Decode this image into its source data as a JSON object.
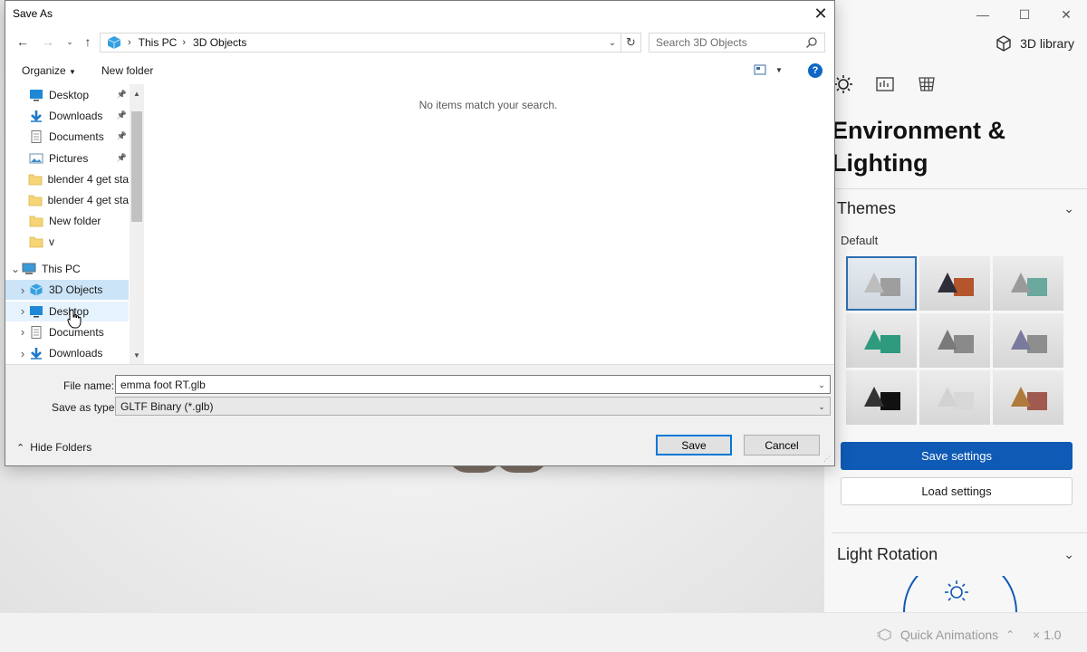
{
  "app": {
    "library_label": "3D library",
    "panel_title": "Environment & Lighting",
    "themes_label": "Themes",
    "themes_default_label": "Default",
    "save_settings": "Save settings",
    "load_settings": "Load settings",
    "light_rotation_label": "Light Rotation",
    "quick_animations": "Quick Animations",
    "speed": "× 1.0",
    "themes": [
      {
        "cone": "#bdbdbd",
        "box": "#9e9e9e",
        "selected": true
      },
      {
        "cone": "#2e2e3a",
        "box": "#b4552d",
        "selected": false
      },
      {
        "cone": "#9a9a9a",
        "box": "#6ba89e",
        "selected": false
      },
      {
        "cone": "#2e9a7e",
        "box": "#2e9a7e",
        "selected": false
      },
      {
        "cone": "#7a7a7a",
        "box": "#8a8a8a",
        "selected": false
      },
      {
        "cone": "#7a7a9e",
        "box": "#8e8e8e",
        "selected": false
      },
      {
        "cone": "#333333",
        "box": "#111111",
        "selected": false
      },
      {
        "cone": "#d2d2d2",
        "box": "#d8d8d8",
        "selected": false
      },
      {
        "cone": "#b07a3a",
        "box": "#a05a50",
        "selected": false
      }
    ]
  },
  "dialog": {
    "title": "Save As",
    "breadcrumb": [
      "This PC",
      "3D Objects"
    ],
    "search_placeholder": "Search 3D Objects",
    "organize": "Organize",
    "new_folder": "New folder",
    "empty_message": "No items match your search.",
    "nav_items": [
      {
        "label": "Desktop",
        "icon": "desktop-icon",
        "pinned": true,
        "indent": 1,
        "expander": "",
        "state": ""
      },
      {
        "label": "Downloads",
        "icon": "downloads-icon",
        "pinned": true,
        "indent": 1,
        "expander": "",
        "state": ""
      },
      {
        "label": "Documents",
        "icon": "documents-icon",
        "pinned": true,
        "indent": 1,
        "expander": "",
        "state": ""
      },
      {
        "label": "Pictures",
        "icon": "pictures-icon",
        "pinned": true,
        "indent": 1,
        "expander": "",
        "state": ""
      },
      {
        "label": "blender 4 get sta",
        "icon": "folder-icon",
        "pinned": false,
        "indent": 1,
        "expander": "",
        "state": ""
      },
      {
        "label": "blender 4 get sta",
        "icon": "folder-icon",
        "pinned": false,
        "indent": 1,
        "expander": "",
        "state": ""
      },
      {
        "label": "New folder",
        "icon": "folder-icon",
        "pinned": false,
        "indent": 1,
        "expander": "",
        "state": ""
      },
      {
        "label": "v",
        "icon": "folder-icon",
        "pinned": false,
        "indent": 1,
        "expander": "",
        "state": ""
      },
      {
        "label": "This PC",
        "icon": "pc-icon",
        "pinned": false,
        "indent": 0,
        "expander": "down",
        "state": ""
      },
      {
        "label": "3D Objects",
        "icon": "objects3d-icon",
        "pinned": false,
        "indent": 1,
        "expander": "right",
        "state": "sel"
      },
      {
        "label": "Desktop",
        "icon": "desktop-icon",
        "pinned": false,
        "indent": 1,
        "expander": "right",
        "state": "hov"
      },
      {
        "label": "Documents",
        "icon": "documents-icon",
        "pinned": false,
        "indent": 1,
        "expander": "right",
        "state": ""
      },
      {
        "label": "Downloads",
        "icon": "downloads-icon",
        "pinned": false,
        "indent": 1,
        "expander": "right",
        "state": ""
      }
    ],
    "file_name_label": "File name:",
    "file_name_value": "emma foot RT.glb",
    "save_type_label": "Save as type:",
    "save_type_value": "GLTF Binary (*.glb)",
    "hide_folders": "Hide Folders",
    "save_button": "Save",
    "cancel_button": "Cancel"
  }
}
